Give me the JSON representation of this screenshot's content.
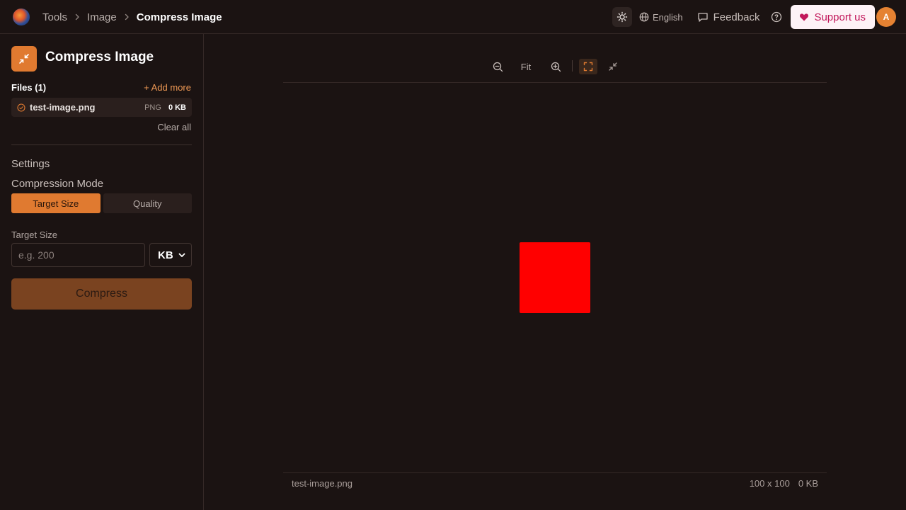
{
  "breadcrumb": {
    "items": [
      "Tools",
      "Image"
    ],
    "current": "Compress Image"
  },
  "topbar": {
    "language": "English",
    "feedback": "Feedback",
    "support": "Support us",
    "avatar_initial": "A"
  },
  "sidebar": {
    "title": "Compress Image",
    "files_label": "Files (1)",
    "add_more": "+ Add more",
    "files": [
      {
        "name": "test-image.png",
        "type": "PNG",
        "size": "0 KB"
      }
    ],
    "clear_all": "Clear all",
    "settings_label": "Settings",
    "compression_mode_label": "Compression Mode",
    "modes": [
      "Target Size",
      "Quality"
    ],
    "active_mode": "Target Size",
    "target_size_label": "Target Size",
    "target_size_placeholder": "e.g. 200",
    "target_size_value": "",
    "unit": "KB",
    "compress_button": "Compress"
  },
  "preview": {
    "toolbar": {
      "fit": "Fit"
    },
    "image_color": "#ff0000",
    "footer": {
      "filename": "test-image.png",
      "dimensions": "100 x 100",
      "size": "0 KB"
    }
  },
  "colors": {
    "accent": "#e07a30",
    "background": "#1b1312",
    "support_text": "#c2185b"
  },
  "icons": {
    "logo": "app-logo",
    "theme": "sun-icon",
    "language": "globe-icon",
    "feedback": "message-square-icon",
    "help": "help-circle-icon",
    "support": "heart-icon",
    "tool": "minimize-arrows-icon",
    "zoom_out": "zoom-out-icon",
    "zoom_in": "zoom-in-icon",
    "fullscreen": "maximize-icon",
    "shrink": "minimize-icon"
  }
}
